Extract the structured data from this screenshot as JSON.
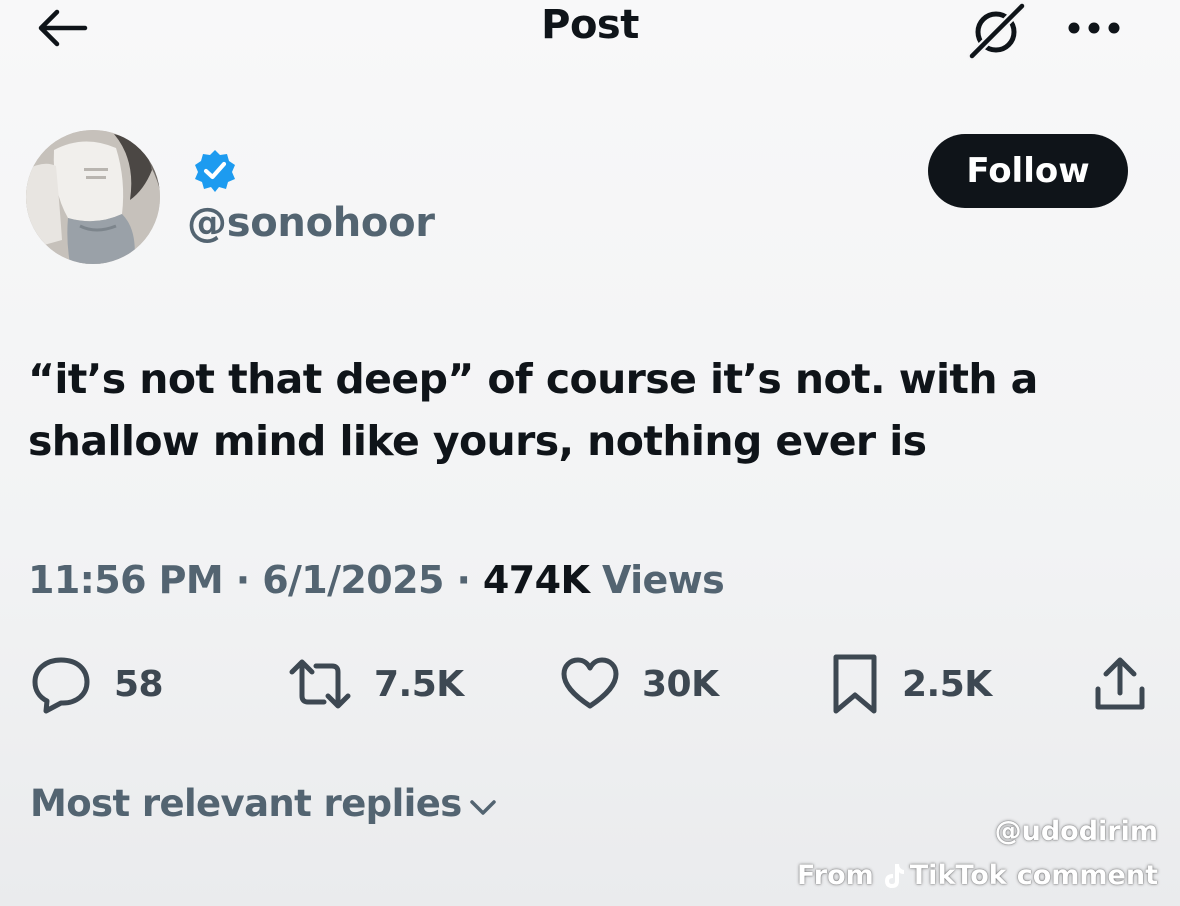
{
  "header": {
    "title": "Post",
    "back_icon": "arrow-left-icon",
    "grok_icon": "grok-icon",
    "more_icon": "more-horizontal-icon"
  },
  "author": {
    "handle": "@sonohoor",
    "verified": true,
    "verified_color": "#1d9bf0",
    "follow_label": "Follow"
  },
  "tweet": {
    "text": "“it’s not that deep” of course it’s not. with a\nshallow mind like yours, nothing ever is",
    "time": "11:56 PM",
    "date": "6/1/2025",
    "views_count": "474K",
    "views_label": "Views",
    "separator": "·"
  },
  "actions": {
    "replies": "58",
    "reposts": "7.5K",
    "likes": "30K",
    "bookmarks": "2.5K"
  },
  "replies_sort": {
    "label": "Most relevant replies"
  },
  "watermark": {
    "user": "@udodirim",
    "from": "From",
    "brand": "TikTok",
    "suffix": "comment"
  },
  "colors": {
    "text_primary": "#0f1419",
    "text_secondary": "#536471",
    "follow_bg": "#0f1419",
    "accent": "#1d9bf0"
  }
}
